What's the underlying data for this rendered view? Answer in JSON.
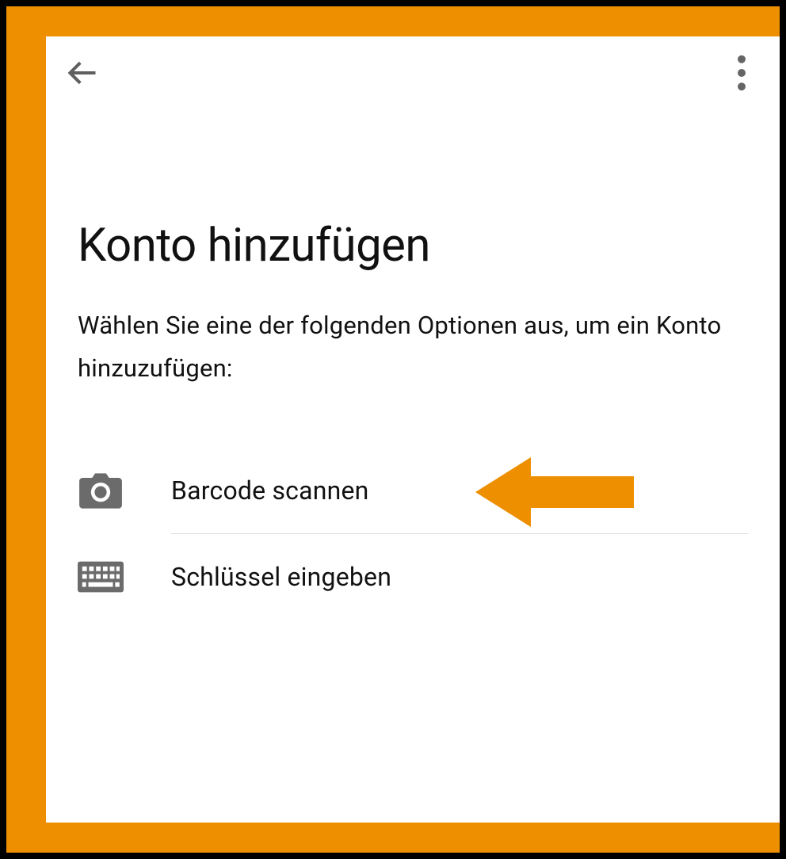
{
  "colors": {
    "accent": "#EE8F00",
    "text": "#111111",
    "icon": "#6b6b6b"
  },
  "header": {
    "back_icon": "back-arrow-icon",
    "more_icon": "more-vertical-icon"
  },
  "page": {
    "title": "Konto hinzufügen",
    "subtitle": "Wählen Sie eine der folgenden Optionen aus, um ein Konto hinzuzufügen:"
  },
  "options": [
    {
      "icon": "camera-icon",
      "label": "Barcode scannen",
      "highlighted": true
    },
    {
      "icon": "keyboard-icon",
      "label": "Schlüssel eingeben",
      "highlighted": false
    }
  ]
}
